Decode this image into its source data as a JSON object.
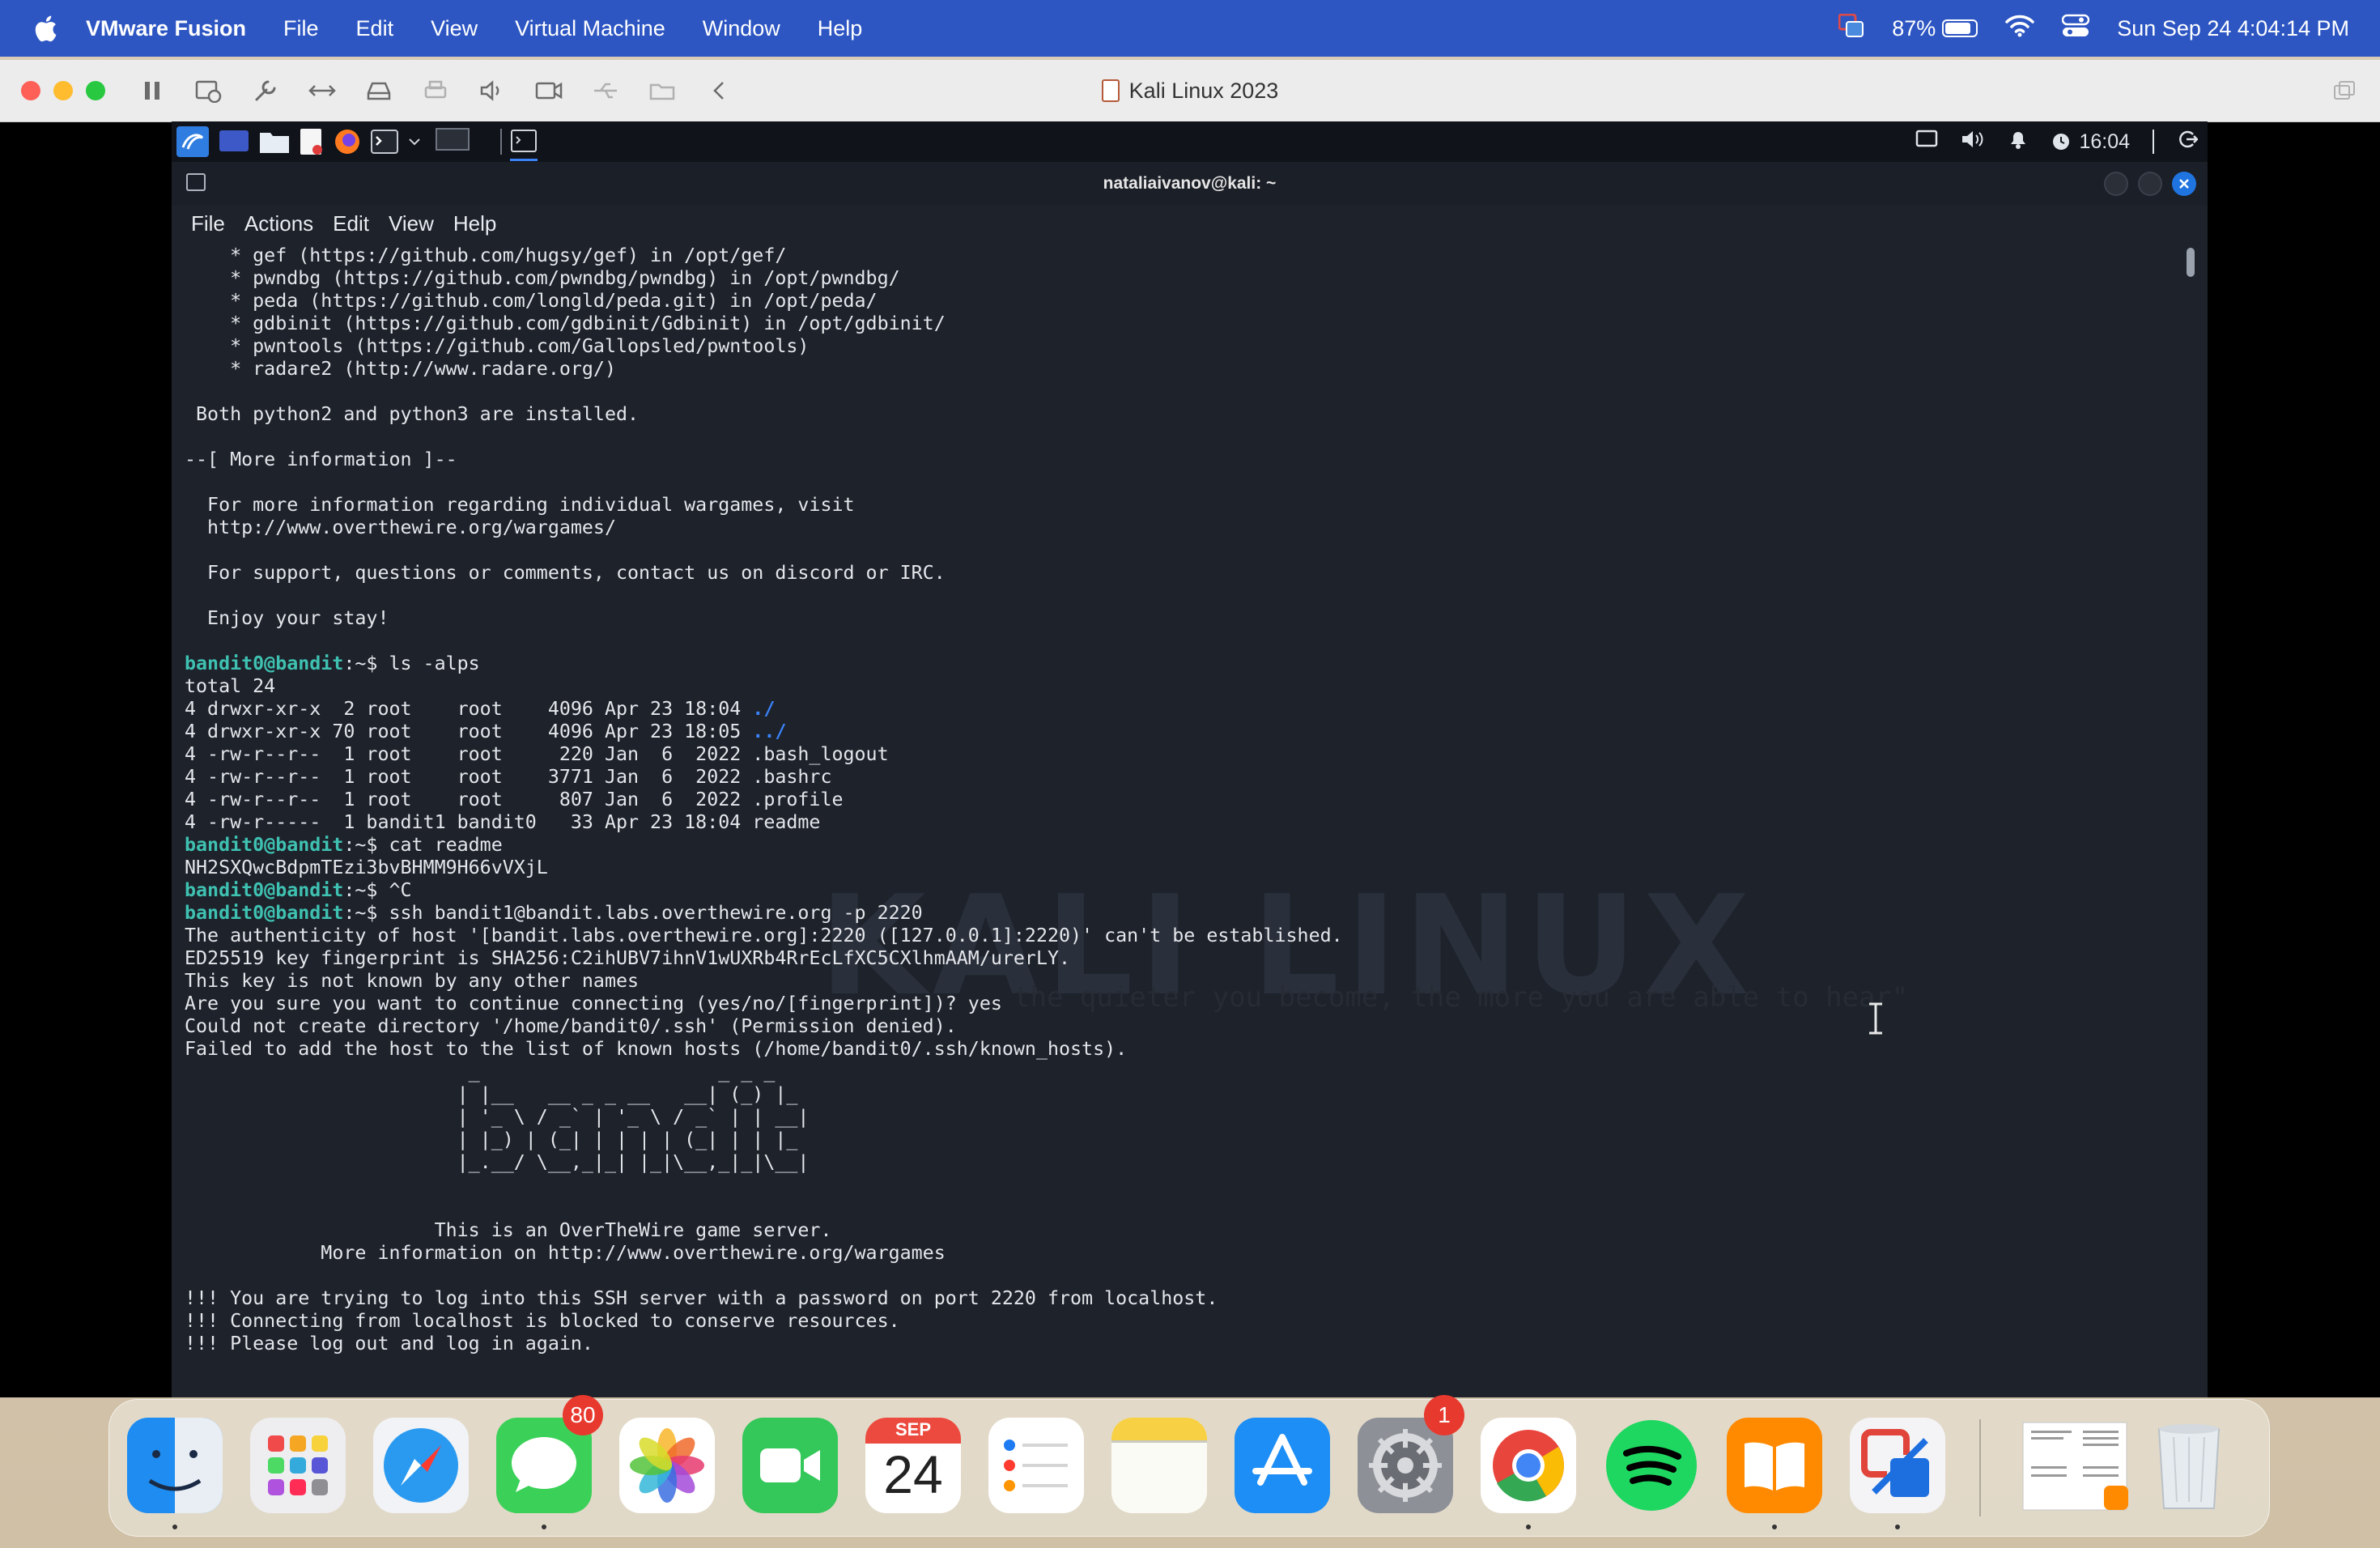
{
  "menubar": {
    "app_name": "VMware Fusion",
    "items": [
      "File",
      "Edit",
      "View",
      "Virtual Machine",
      "Window",
      "Help"
    ],
    "battery_percent": "87%",
    "battery_level": 0.87,
    "datetime": "Sun Sep 24  4:04:14 PM"
  },
  "vm_window": {
    "title": "Kali Linux 2023"
  },
  "kali_panel": {
    "clock": "16:04"
  },
  "terminal": {
    "title": "nataliaivanov@kali: ~",
    "menu": [
      "File",
      "Actions",
      "Edit",
      "View",
      "Help"
    ],
    "watermark": "KALI LINUX",
    "watermark_quote": "the quieter you become, the more you are able to hear\"",
    "lines": [
      {
        "text": "    * gef (https://github.com/hugsy/gef) in /opt/gef/"
      },
      {
        "text": "    * pwndbg (https://github.com/pwndbg/pwndbg) in /opt/pwndbg/"
      },
      {
        "text": "    * peda (https://github.com/longld/peda.git) in /opt/peda/"
      },
      {
        "text": "    * gdbinit (https://github.com/gdbinit/Gdbinit) in /opt/gdbinit/"
      },
      {
        "text": "    * pwntools (https://github.com/Gallopsled/pwntools)"
      },
      {
        "text": "    * radare2 (http://www.radare.org/)"
      },
      {
        "text": ""
      },
      {
        "text": " Both python2 and python3 are installed."
      },
      {
        "text": ""
      },
      {
        "text": "--[ More information ]--"
      },
      {
        "text": ""
      },
      {
        "text": "  For more information regarding individual wargames, visit"
      },
      {
        "text": "  http://www.overthewire.org/wargames/"
      },
      {
        "text": ""
      },
      {
        "text": "  For support, questions or comments, contact us on discord or IRC."
      },
      {
        "text": ""
      },
      {
        "text": "  Enjoy your stay!"
      },
      {
        "text": ""
      },
      {
        "prompt": "bandit0@bandit",
        "cmd": ":~$ ls -alps"
      },
      {
        "text": "total 24"
      },
      {
        "text": "4 drwxr-xr-x  2 root    root    4096 Apr 23 18:04 ",
        "link": "./"
      },
      {
        "text": "4 drwxr-xr-x 70 root    root    4096 Apr 23 18:05 ",
        "link": "../"
      },
      {
        "text": "4 -rw-r--r--  1 root    root     220 Jan  6  2022 .bash_logout"
      },
      {
        "text": "4 -rw-r--r--  1 root    root    3771 Jan  6  2022 .bashrc"
      },
      {
        "text": "4 -rw-r--r--  1 root    root     807 Jan  6  2022 .profile"
      },
      {
        "text": "4 -rw-r-----  1 bandit1 bandit0   33 Apr 23 18:04 readme"
      },
      {
        "prompt": "bandit0@bandit",
        "cmd": ":~$ cat readme"
      },
      {
        "text": "NH2SXQwcBdpmTEzi3bvBHMM9H66vVXjL"
      },
      {
        "prompt": "bandit0@bandit",
        "cmd": ":~$ ^C"
      },
      {
        "prompt": "bandit0@bandit",
        "cmd": ":~$ ssh bandit1@bandit.labs.overthewire.org -p 2220"
      },
      {
        "text": "The authenticity of host '[bandit.labs.overthewire.org]:2220 ([127.0.0.1]:2220)' can't be established."
      },
      {
        "text": "ED25519 key fingerprint is SHA256:C2ihUBV7ihnV1wUXRb4RrEcLfXC5CXlhmAAM/urerLY."
      },
      {
        "text": "This key is not known by any other names"
      },
      {
        "text": "Are you sure you want to continue connecting (yes/no/[fingerprint])? yes"
      },
      {
        "text": "Could not create directory '/home/bandit0/.ssh' (Permission denied)."
      },
      {
        "text": "Failed to add the host to the list of known hosts (/home/bandit0/.ssh/known_hosts)."
      },
      {
        "text": "                         _                     _ _ _   "
      },
      {
        "text": "                        | |__   __ _ _ __   __| (_) |_ "
      },
      {
        "text": "                        | '_ \\ / _` | '_ \\ / _` | | __|"
      },
      {
        "text": "                        | |_) | (_| | | | | (_| | | |_ "
      },
      {
        "text": "                        |_.__/ \\__,_|_| |_|\\__,_|_|\\__|"
      },
      {
        "text": ""
      },
      {
        "text": ""
      },
      {
        "text": "                      This is an OverTheWire game server."
      },
      {
        "text": "            More information on http://www.overthewire.org/wargames"
      },
      {
        "text": ""
      },
      {
        "text": "!!! You are trying to log into this SSH server with a password on port 2220 from localhost."
      },
      {
        "text": "!!! Connecting from localhost is blocked to conserve resources."
      },
      {
        "text": "!!! Please log out and log in again."
      }
    ]
  },
  "dock": {
    "apps": [
      {
        "name": "Finder",
        "running": true
      },
      {
        "name": "Launchpad",
        "running": false
      },
      {
        "name": "Safari",
        "running": false
      },
      {
        "name": "Messages",
        "running": true,
        "badge": "80"
      },
      {
        "name": "Photos",
        "running": false
      },
      {
        "name": "FaceTime",
        "running": false
      },
      {
        "name": "Calendar",
        "running": false,
        "month": "SEP",
        "day": "24"
      },
      {
        "name": "Reminders",
        "running": false
      },
      {
        "name": "Notes",
        "running": false
      },
      {
        "name": "App Store",
        "running": false
      },
      {
        "name": "System Settings",
        "running": false,
        "badge": "1"
      },
      {
        "name": "Google Chrome",
        "running": true
      },
      {
        "name": "Spotify",
        "running": false
      },
      {
        "name": "Books",
        "running": true
      },
      {
        "name": "VMware Fusion",
        "running": true
      },
      {
        "name": "Document Preview",
        "running": false
      },
      {
        "name": "Trash",
        "running": false
      }
    ]
  }
}
